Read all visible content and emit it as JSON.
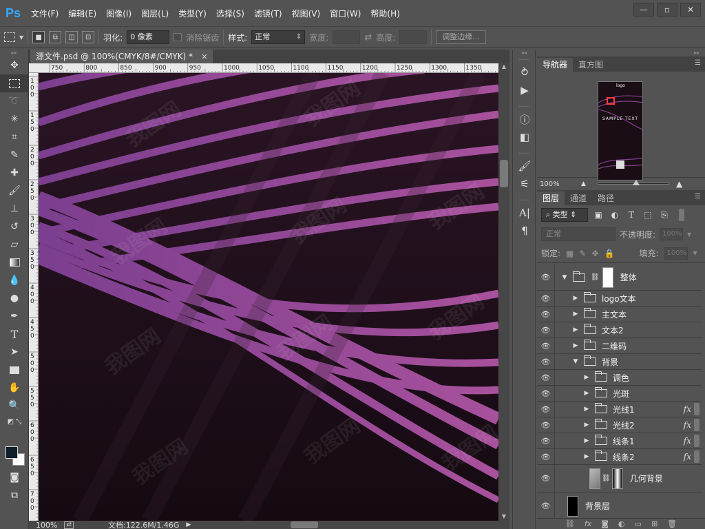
{
  "app": {
    "logo": "Ps",
    "menu": [
      "文件(F)",
      "编辑(E)",
      "图像(I)",
      "图层(L)",
      "类型(Y)",
      "选择(S)",
      "滤镜(T)",
      "视图(V)",
      "窗口(W)",
      "帮助(H)"
    ],
    "window_controls": [
      "—",
      "▫",
      "✕"
    ]
  },
  "options_bar": {
    "feather_label": "羽化:",
    "feather_value": "0 像素",
    "antialias_label": "消除锯齿",
    "style_label": "样式:",
    "style_value": "正常",
    "width_label": "宽度:",
    "height_label": "高度:",
    "refine_edge_label": "调整边缘..."
  },
  "document": {
    "tab_title": "源文件.psd @ 100%(CMYK/8#/CMYK) *",
    "tab_close": "×",
    "ruler_top_ticks": [
      "750",
      "800",
      "850",
      "900",
      "950",
      "1000",
      "1050",
      "1100",
      "1150",
      "1200",
      "1250",
      "1300",
      "1350"
    ],
    "ruler_left_ticks": [
      "1",
      "0",
      "0",
      "1",
      "5",
      "0",
      "2",
      "0",
      "0",
      "2",
      "5",
      "0",
      "3",
      "0",
      "0",
      "3",
      "5",
      "0",
      "4",
      "0",
      "0",
      "4",
      "5",
      "0",
      "5",
      "0",
      "0",
      "5",
      "5",
      "0",
      "6",
      "0",
      "0",
      "6",
      "5",
      "0",
      "7",
      "0",
      "0"
    ],
    "status_zoom": "100%",
    "status_doc": "文档:122.6M/1.46G",
    "watermark_text": "我图网"
  },
  "navigator": {
    "tabs": [
      "导航器",
      "直方图"
    ],
    "zoom": "100%",
    "thumb_title": "SAMPLE TEXT",
    "thumb_top_text": "logo"
  },
  "layers": {
    "tabs": [
      "图层",
      "通道",
      "路径"
    ],
    "filter_value": "类型",
    "blend_mode": "正常",
    "opacity_label": "不透明度:",
    "opacity_value": "100%",
    "lock_label": "锁定:",
    "fill_label": "填充:",
    "fill_value": "100%",
    "rows": [
      {
        "name": "整体",
        "kind": "group-open-mask",
        "indent": 0,
        "fx": false
      },
      {
        "name": "logo文本",
        "kind": "group",
        "indent": 1,
        "fx": false
      },
      {
        "name": "主文本",
        "kind": "group",
        "indent": 1,
        "fx": false
      },
      {
        "name": "文本2",
        "kind": "group",
        "indent": 1,
        "fx": false
      },
      {
        "name": "二维码",
        "kind": "group",
        "indent": 1,
        "fx": false
      },
      {
        "name": "背景",
        "kind": "group-open",
        "indent": 1,
        "fx": false
      },
      {
        "name": "调色",
        "kind": "group",
        "indent": 2,
        "fx": false
      },
      {
        "name": "光斑",
        "kind": "group",
        "indent": 2,
        "fx": false
      },
      {
        "name": "光线1",
        "kind": "group",
        "indent": 2,
        "fx": true
      },
      {
        "name": "光线2",
        "kind": "group",
        "indent": 2,
        "fx": true
      },
      {
        "name": "线条1",
        "kind": "group",
        "indent": 2,
        "fx": true
      },
      {
        "name": "线条2",
        "kind": "group",
        "indent": 2,
        "fx": true
      },
      {
        "name": "几何背景",
        "kind": "layer-mask",
        "indent": 2,
        "fx": false
      },
      {
        "name": "背景层",
        "kind": "layer-black",
        "indent": 1,
        "fx": false
      }
    ],
    "fx_symbol": "fx",
    "footer_icons": [
      "link-icon",
      "fx-icon",
      "mask-icon",
      "adjustment-icon",
      "folder-icon",
      "new-layer-icon",
      "trash-icon"
    ]
  },
  "colors": {
    "canvas_bg": "#1e0f1a",
    "stripe": "#9b4fa6",
    "ps_blue": "#31a8ff"
  }
}
